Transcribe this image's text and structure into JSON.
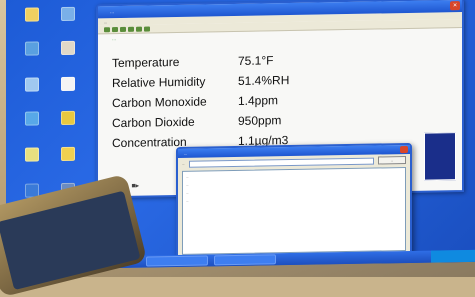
{
  "window": {
    "title": "...",
    "menu": "..."
  },
  "subtitle": "...",
  "readings": [
    {
      "label": "Temperature",
      "value": "75.1°F"
    },
    {
      "label": "Relative Humidity",
      "value": "51.4%RH"
    },
    {
      "label": "Carbon Monoxide",
      "value": "1.4ppm"
    },
    {
      "label": "Carbon Dioxide",
      "value": "950ppm"
    },
    {
      "label": "Concentration",
      "value": "1.1µg/m3"
    }
  ],
  "dialog": {
    "title": "...",
    "status": "...",
    "button": "...",
    "paragraphs": [
      "...",
      "...",
      "...",
      "..."
    ]
  },
  "colors": {
    "desktop": "#2a6ae6",
    "titlebar": "#1e56d0",
    "accent_green": "#2f9a3a"
  }
}
